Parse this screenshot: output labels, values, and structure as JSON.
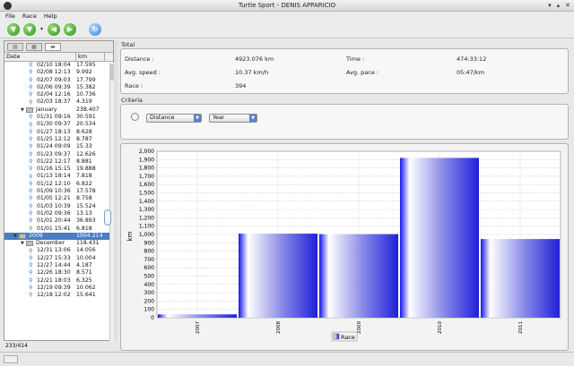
{
  "window": {
    "title": "Turtle Sport - DENIS APPARICIO",
    "controls": [
      "▾",
      "▴",
      "✕"
    ]
  },
  "menu": [
    "File",
    "Race",
    "Help"
  ],
  "toolbar": {
    "icons": [
      "filter-icon",
      "filter-icon",
      "back-icon",
      "forward-icon",
      "refresh-icon"
    ]
  },
  "left_tabs": [
    "▤",
    "▦",
    "▬"
  ],
  "table": {
    "headers": [
      "Date",
      "km"
    ],
    "rows": [
      {
        "indent": 3,
        "type": "run",
        "date": "02/10 18:04",
        "km": "17.595"
      },
      {
        "indent": 3,
        "type": "run",
        "date": "02/08 12:13",
        "km": "9.992"
      },
      {
        "indent": 3,
        "type": "run",
        "date": "02/07 09:03",
        "km": "17.799"
      },
      {
        "indent": 3,
        "type": "run",
        "date": "02/06 09:39",
        "km": "15.382"
      },
      {
        "indent": 3,
        "type": "run",
        "date": "02/04 12:16",
        "km": "10.736"
      },
      {
        "indent": 3,
        "type": "run",
        "date": "02/03 18:37",
        "km": "4.319"
      },
      {
        "indent": 2,
        "type": "folder",
        "date": "January",
        "km": "238.407"
      },
      {
        "indent": 3,
        "type": "run",
        "date": "01/31 09:16",
        "km": "30.591"
      },
      {
        "indent": 3,
        "type": "run",
        "date": "01/30 09:37",
        "km": "20.534"
      },
      {
        "indent": 3,
        "type": "run",
        "date": "01/27 18:13",
        "km": "8.628"
      },
      {
        "indent": 3,
        "type": "run",
        "date": "01/25 12:12",
        "km": "8.787"
      },
      {
        "indent": 3,
        "type": "run",
        "date": "01/24 09:09",
        "km": "15.33"
      },
      {
        "indent": 3,
        "type": "run",
        "date": "01/23 09:37",
        "km": "12.626"
      },
      {
        "indent": 3,
        "type": "run",
        "date": "01/22 12:17",
        "km": "8.881"
      },
      {
        "indent": 3,
        "type": "run",
        "date": "01/16 15:15",
        "km": "19.888"
      },
      {
        "indent": 3,
        "type": "run",
        "date": "01/13 18:14",
        "km": "7.818"
      },
      {
        "indent": 3,
        "type": "run",
        "date": "01/12 12:10",
        "km": "6.822"
      },
      {
        "indent": 3,
        "type": "run",
        "date": "01/09 10:36",
        "km": "17.578"
      },
      {
        "indent": 3,
        "type": "run",
        "date": "01/05 12:21",
        "km": "8.758"
      },
      {
        "indent": 3,
        "type": "run",
        "date": "01/03 10:39",
        "km": "15.524"
      },
      {
        "indent": 3,
        "type": "run",
        "date": "01/02 09:36",
        "km": "13.13"
      },
      {
        "indent": 3,
        "type": "run",
        "date": "01/01 20:44",
        "km": "36.893"
      },
      {
        "indent": 3,
        "type": "run",
        "date": "01/01 15:41",
        "km": "6.818"
      },
      {
        "indent": 1,
        "type": "folder",
        "date": "2009",
        "km": "1004.214",
        "selected": true
      },
      {
        "indent": 2,
        "type": "folder",
        "date": "December",
        "km": "118.431"
      },
      {
        "indent": 3,
        "type": "run",
        "date": "12/31 13:06",
        "km": "14.056"
      },
      {
        "indent": 3,
        "type": "run",
        "date": "12/27 15:33",
        "km": "10.004"
      },
      {
        "indent": 3,
        "type": "run",
        "date": "12/27 14:44",
        "km": "4.187"
      },
      {
        "indent": 3,
        "type": "run",
        "date": "12/26 18:30",
        "km": "8.571"
      },
      {
        "indent": 3,
        "type": "run",
        "date": "12/21 18:03",
        "km": "6.325"
      },
      {
        "indent": 3,
        "type": "run",
        "date": "12/19 09:39",
        "km": "10.062"
      },
      {
        "indent": 3,
        "type": "run",
        "date": "12/18 12:02",
        "km": "15.641"
      }
    ]
  },
  "status_left": "233/414",
  "total": {
    "title": "Total",
    "distance_label": "Distance :",
    "distance_value": "4923.076 km",
    "time_label": "Time :",
    "time_value": "474:33:12",
    "speed_label": "Avg. speed :",
    "speed_value": "10.37 km/h",
    "pace_label": "Avg. pace :",
    "pace_value": "05:47/km",
    "race_label": "Race :",
    "race_value": "394"
  },
  "criteria": {
    "title": "Criteria",
    "metric": "Distance",
    "period": "Year"
  },
  "chart_data": {
    "type": "bar",
    "categories": [
      "2007",
      "2008",
      "2009",
      "2010",
      "2011"
    ],
    "values": [
      40,
      1010,
      1004,
      1920,
      945
    ],
    "ylabel": "km",
    "ylim": [
      0,
      2000
    ],
    "yticks": [
      "0",
      "100",
      "200",
      "300",
      "400",
      "500",
      "600",
      "700",
      "800",
      "900",
      "1,000",
      "1,100",
      "1,200",
      "1,300",
      "1,400",
      "1,500",
      "1,600",
      "1,700",
      "1,800",
      "1,900",
      "2,000"
    ],
    "legend": "Race",
    "legend_position": "bottom",
    "grid": true,
    "colors": {
      "bar_edge": "#1a1ae0",
      "bar_mid": "#ffffff",
      "grid": "#aaaaaa"
    }
  }
}
